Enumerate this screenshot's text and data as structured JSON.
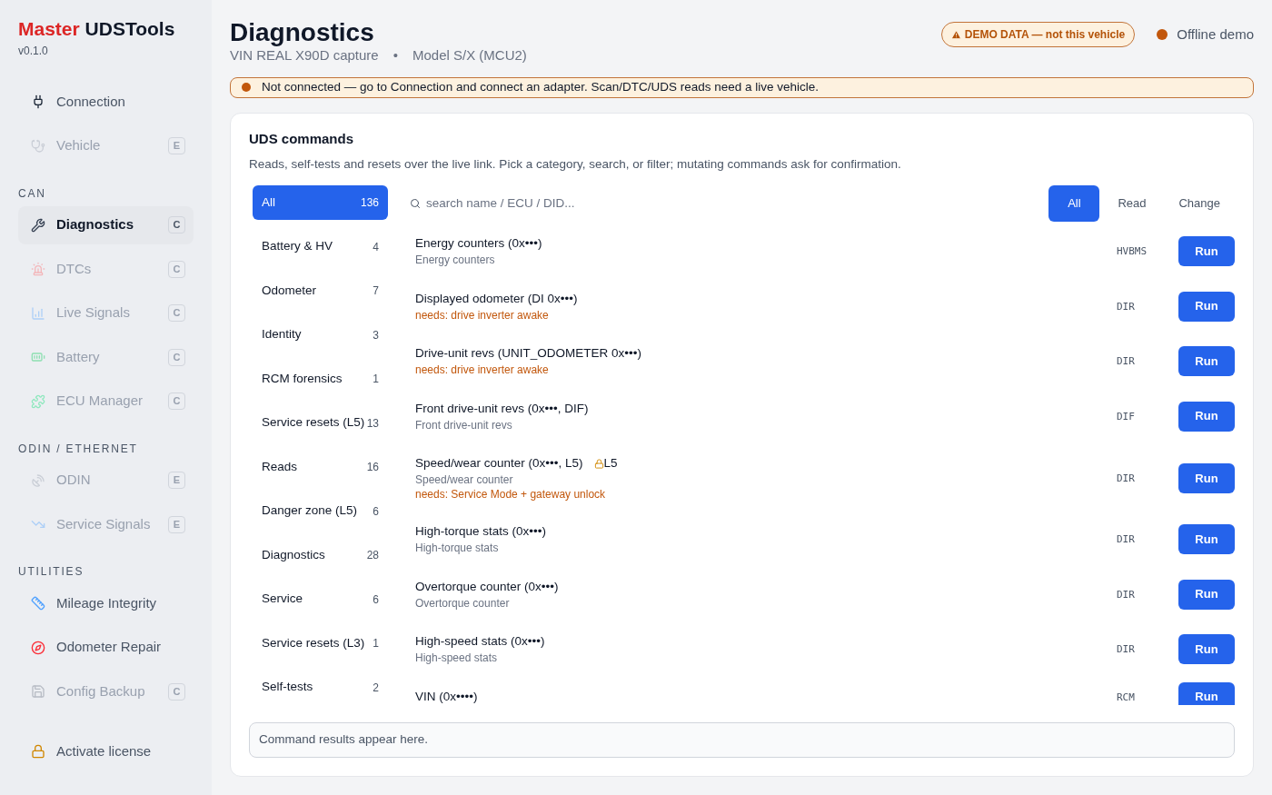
{
  "brand": {
    "first": "Master",
    "second": "UDSTools",
    "version": "v0.1.0"
  },
  "sidebar": {
    "groups": [
      {
        "items": [
          {
            "label": "Connection",
            "disabled": false,
            "selected": false
          },
          {
            "label": "Vehicle",
            "badge": "E",
            "disabled": true,
            "selected": false
          }
        ]
      },
      {
        "header": "CAN",
        "items": [
          {
            "label": "Diagnostics",
            "badge": "C",
            "disabled": false,
            "selected": true
          },
          {
            "label": "DTCs",
            "badge": "C",
            "disabled": true,
            "selected": false
          },
          {
            "label": "Live Signals",
            "badge": "C",
            "disabled": true,
            "selected": false
          },
          {
            "label": "Battery",
            "badge": "C",
            "disabled": true,
            "selected": false
          },
          {
            "label": "ECU Manager",
            "badge": "C",
            "disabled": true,
            "selected": false
          }
        ]
      },
      {
        "header": "ODIN / ETHERNET",
        "items": [
          {
            "label": "ODIN",
            "badge": "E",
            "disabled": true,
            "selected": false
          },
          {
            "label": "Service Signals",
            "badge": "E",
            "disabled": true,
            "selected": false
          }
        ]
      },
      {
        "header": "UTILITIES",
        "items": [
          {
            "label": "Mileage Integrity",
            "disabled": false,
            "selected": false
          },
          {
            "label": "Odometer Repair",
            "disabled": false,
            "selected": false
          },
          {
            "label": "Config Backup",
            "badge": "C",
            "disabled": true,
            "selected": false
          }
        ]
      },
      {
        "items": [
          {
            "label": "Activate license",
            "disabled": false,
            "selected": false
          }
        ]
      }
    ]
  },
  "header": {
    "title": "Diagnostics",
    "vin": "VIN REAL X90D capture",
    "separator": "•",
    "model": "Model S/X (MCU2)",
    "demo_badge": "DEMO DATA — not this vehicle",
    "status": "Offline demo"
  },
  "alert": "Not connected — go to Connection and connect an adapter. Scan/DTC/UDS reads need a live vehicle.",
  "panel": {
    "title": "UDS commands",
    "description": "Reads, self-tests and resets over the live link. Pick a category, search, or filter; mutating commands ask for confirmation.",
    "categories": [
      {
        "label": "All",
        "count": "136",
        "selected": true
      },
      {
        "label": "Battery & HV",
        "count": "4",
        "selected": false
      },
      {
        "label": "Odometer",
        "count": "7",
        "selected": false
      },
      {
        "label": "Identity",
        "count": "3",
        "selected": false
      },
      {
        "label": "RCM forensics",
        "count": "1",
        "selected": false
      },
      {
        "label": "Service resets (L5)",
        "count": "13",
        "selected": false
      },
      {
        "label": "Reads",
        "count": "16",
        "selected": false
      },
      {
        "label": "Danger zone (L5)",
        "count": "6",
        "selected": false
      },
      {
        "label": "Diagnostics",
        "count": "28",
        "selected": false
      },
      {
        "label": "Service",
        "count": "6",
        "selected": false
      },
      {
        "label": "Service resets (L3)",
        "count": "1",
        "selected": false
      },
      {
        "label": "Self-tests",
        "count": "2",
        "selected": false
      }
    ],
    "search_placeholder": "search name / ECU / DID...",
    "filters": [
      {
        "label": "All",
        "selected": true
      },
      {
        "label": "Read",
        "selected": false
      },
      {
        "label": "Change",
        "selected": false
      }
    ],
    "commands": [
      {
        "name": "Energy counters (0x•••)",
        "subtitle": "Energy counters",
        "ecu": "HVBMS",
        "action": "Run"
      },
      {
        "name": "Displayed odometer (DI 0x•••)",
        "needs": "needs: drive inverter awake",
        "ecu": "DIR",
        "action": "Run"
      },
      {
        "name": "Drive-unit revs (UNIT_ODOMETER 0x•••)",
        "needs": "needs: drive inverter awake",
        "ecu": "DIR",
        "action": "Run"
      },
      {
        "name": "Front drive-unit revs (0x•••, DIF)",
        "subtitle": "Front drive-unit revs",
        "ecu": "DIF",
        "action": "Run"
      },
      {
        "name": "Speed/wear counter (0x•••, L5)",
        "lock": "L5",
        "subtitle": "Speed/wear counter",
        "needs": "needs: Service Mode + gateway unlock",
        "ecu": "DIR",
        "action": "Run"
      },
      {
        "name": "High-torque stats (0x•••)",
        "subtitle": "High-torque stats",
        "ecu": "DIR",
        "action": "Run"
      },
      {
        "name": "Overtorque counter (0x•••)",
        "subtitle": "Overtorque counter",
        "ecu": "DIR",
        "action": "Run"
      },
      {
        "name": "High-speed stats (0x•••)",
        "subtitle": "High-speed stats",
        "ecu": "DIR",
        "action": "Run"
      },
      {
        "name": "VIN (0x••••)",
        "ecu": "RCM",
        "action": "Run"
      }
    ],
    "results_placeholder": "Command results appear here."
  }
}
